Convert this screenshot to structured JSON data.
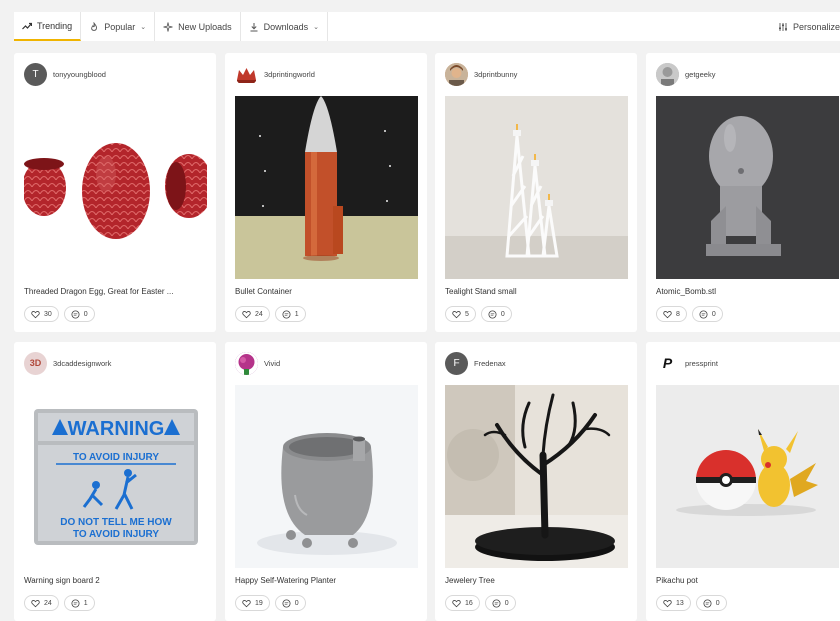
{
  "tabs": [
    {
      "key": "trending",
      "label": "Trending",
      "icon": "trending-icon",
      "dropdown": false,
      "active": true
    },
    {
      "key": "popular",
      "label": "Popular",
      "icon": "flame-icon",
      "dropdown": true,
      "active": false
    },
    {
      "key": "new_uploads",
      "label": "New Uploads",
      "icon": "sparkle-icon",
      "dropdown": false,
      "active": false
    },
    {
      "key": "downloads",
      "label": "Downloads",
      "icon": "download-icon",
      "dropdown": true,
      "active": false
    }
  ],
  "personalize_label": "Personalize",
  "accent_color": "#f0b400",
  "cards": [
    {
      "user": "tonyyoungblood",
      "avatar_letter": "T",
      "avatar_color": "#5a5a5a",
      "title": "Threaded Dragon Egg, Great for Easter ...",
      "likes": "30",
      "comments": "0",
      "image": "red dragon egg"
    },
    {
      "user": "3dprintingworld",
      "avatar_letter": "",
      "avatar_color": "#c0392b",
      "title": "Bullet Container",
      "likes": "24",
      "comments": "1",
      "image": "copper bullet"
    },
    {
      "user": "3dprintbunny",
      "avatar_letter": "",
      "avatar_color": "#d9a07a",
      "title": "Tealight Stand small",
      "likes": "5",
      "comments": "0",
      "image": "white lattice tealight stand"
    },
    {
      "user": "getgeeky",
      "avatar_letter": "",
      "avatar_color": "#b5b5b5",
      "title": "Atomic_Bomb.stl",
      "likes": "8",
      "comments": "0",
      "image": "grey bomb model"
    },
    {
      "user": "3dcaddesignwork",
      "avatar_letter": "3D",
      "avatar_color": "#e8d3d3",
      "title": "Warning sign board 2",
      "likes": "24",
      "comments": "1",
      "image": "warning sign",
      "sign_lines": [
        "WARNING",
        "TO AVOID INJURY",
        "DO NOT TELL ME HOW",
        "TO AVOID INJURY"
      ]
    },
    {
      "user": "Vivid",
      "avatar_letter": "",
      "avatar_color": "#8e3b8e",
      "title": "Happy Self-Watering Planter",
      "likes": "19",
      "comments": "0",
      "image": "grey planter"
    },
    {
      "user": "Fredenax",
      "avatar_letter": "F",
      "avatar_color": "#5a5a5a",
      "title": "Jewelery Tree",
      "likes": "16",
      "comments": "0",
      "image": "black jewelry tree"
    },
    {
      "user": "pressprint",
      "avatar_letter": "P",
      "avatar_color": "#ffffff",
      "title": "Pikachu pot",
      "likes": "13",
      "comments": "0",
      "image": "pokeball and pikachu"
    }
  ]
}
